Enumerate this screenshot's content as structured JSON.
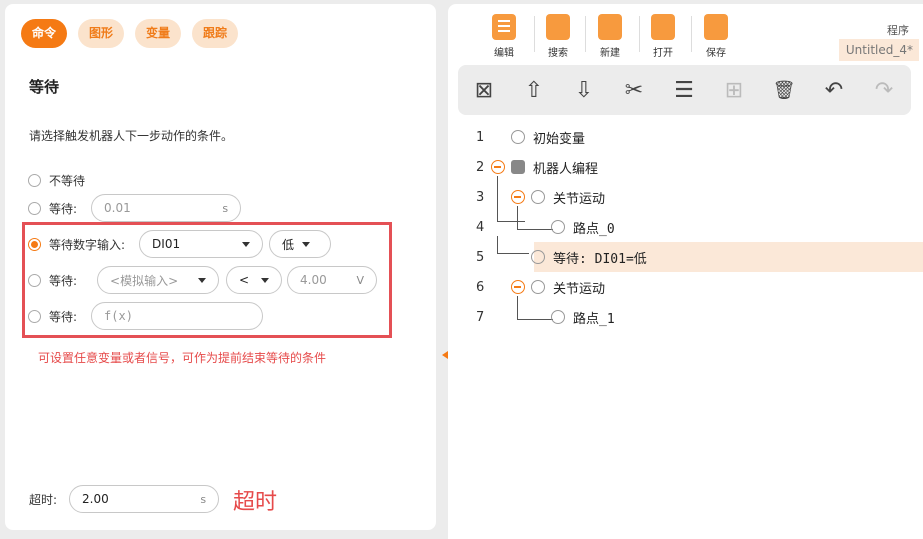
{
  "left": {
    "tabs": [
      {
        "label": "命令",
        "active": true
      },
      {
        "label": "图形",
        "active": false
      },
      {
        "label": "变量",
        "active": false
      },
      {
        "label": "跟踪",
        "active": false
      }
    ],
    "title": "等待",
    "description": "请选择触发机器人下一步动作的条件。",
    "options": {
      "no_wait": {
        "label": "不等待"
      },
      "wait_time": {
        "label": "等待:",
        "value": "0.01",
        "unit": "s"
      },
      "wait_digital": {
        "label": "等待数字输入:",
        "input": "DI01",
        "level": "低"
      },
      "wait_analog": {
        "label": "等待:",
        "input_placeholder": "<模拟输入>",
        "operator": "<",
        "value": "4.00",
        "unit": "V"
      },
      "wait_expr": {
        "label": "等待:",
        "placeholder": "f(x)"
      }
    },
    "note": "可设置任意变量或者信号，可作为提前结束等待的条件",
    "timeout": {
      "label": "超时:",
      "value": "2.00",
      "unit": "s",
      "annotation": "超时"
    }
  },
  "right": {
    "top_buttons": [
      {
        "label": "编辑",
        "icon": "edit-icon"
      },
      {
        "label": "搜索",
        "icon": "search-icon"
      },
      {
        "label": "新建",
        "icon": "new-file-icon"
      },
      {
        "label": "打开",
        "icon": "open-folder-icon"
      },
      {
        "label": "保存",
        "icon": "save-icon"
      }
    ],
    "program_label": "程序",
    "program_name": "Untitled_4*",
    "toolbar": [
      {
        "icon": "delete-box-icon",
        "glyph": "⊠",
        "enabled": true
      },
      {
        "icon": "move-up-icon",
        "glyph": "⇧",
        "enabled": true
      },
      {
        "icon": "move-down-icon",
        "glyph": "⇩",
        "enabled": true
      },
      {
        "icon": "cut-icon",
        "glyph": "✂",
        "enabled": true
      },
      {
        "icon": "copy-icon",
        "glyph": "☰",
        "enabled": true
      },
      {
        "icon": "paste-icon",
        "glyph": "⊞",
        "enabled": false
      },
      {
        "icon": "trash-icon",
        "glyph": "🗑",
        "enabled": true
      },
      {
        "icon": "undo-icon",
        "glyph": "↶",
        "enabled": true
      },
      {
        "icon": "redo-icon",
        "glyph": "↷",
        "enabled": false
      }
    ],
    "tree": [
      {
        "num": "1",
        "text": "初始变量"
      },
      {
        "num": "2",
        "text": "机器人编程"
      },
      {
        "num": "3",
        "text": "关节运动"
      },
      {
        "num": "4",
        "text": "路点_0"
      },
      {
        "num": "5",
        "text": "等待: DI01=低"
      },
      {
        "num": "6",
        "text": "关节运动"
      },
      {
        "num": "7",
        "text": "路点_1"
      }
    ]
  }
}
